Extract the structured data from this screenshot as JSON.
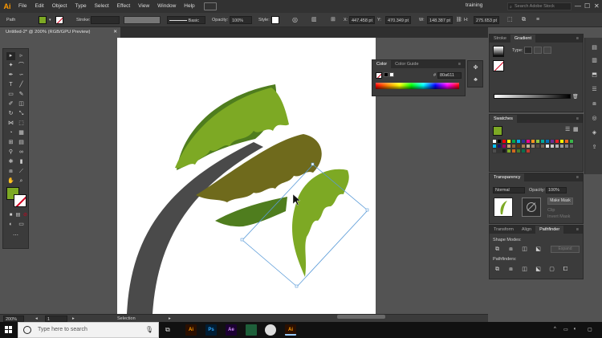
{
  "app": {
    "logo": "Ai",
    "menu": [
      "File",
      "Edit",
      "Object",
      "Type",
      "Select",
      "Effect",
      "View",
      "Window",
      "Help"
    ],
    "workspace": "training",
    "stock_search_placeholder": "Search Adobe Stock",
    "window_buttons": [
      "—",
      "☐",
      "✕"
    ]
  },
  "control_bar": {
    "selection_type": "Path",
    "stroke_label": "Stroke:",
    "brush_label": "Basic",
    "opacity_label": "Opacity:",
    "opacity_value": "100%",
    "style_label": "Style:",
    "x_label": "X:",
    "x_value": "447.458 pt",
    "y_label": "Y:",
    "y_value": "470.349 pt",
    "w_label": "W:",
    "w_value": "148.387 pt",
    "h_label": "H:",
    "h_value": "275.653 pt",
    "fill_color": "#7da924"
  },
  "document": {
    "tab_title": "Untitled-2* @ 200% (RGB/GPU Preview)",
    "close_glyph": "✕"
  },
  "status_bar": {
    "zoom": "200%",
    "artboard_number": "1",
    "tool_name": "Selection"
  },
  "color_panel": {
    "tabs": [
      "Color",
      "Color Guide"
    ],
    "hex_prefix": "#",
    "hex_value": "80a611"
  },
  "stroke_gradient_panel": {
    "tabs": [
      "Stroke",
      "Gradient"
    ],
    "type_label": "Type:"
  },
  "swatches_panel": {
    "title": "Swatches",
    "colors": [
      "#ffffff",
      "#000000",
      "#ff0000",
      "#ffff00",
      "#00a651",
      "#00aeef",
      "#2e3192",
      "#ec008c",
      "#f7941d",
      "#8dc63f",
      "#00a99d",
      "#0072bc",
      "#662d91",
      "#ed1c24",
      "#fff200",
      "#f26522",
      "#39b54a",
      "#00bff3",
      "#1b1464",
      "#9e005d",
      "#c69c6d",
      "#8c6239",
      "#603913",
      "#a67c52",
      "#c2b59b",
      "#998675",
      "#534741",
      "#736357",
      "#e6e6e6",
      "#cccccc",
      "#b3b3b3",
      "#999999",
      "#808080",
      "#666666",
      "#4d4d4d",
      "#333333",
      "#1a1a1a",
      "#7da924",
      "#d2691e",
      "#4a7c2a",
      "#0b6e4f",
      "#c0392b"
    ]
  },
  "transparency_panel": {
    "title": "Transparency",
    "blend_mode": "Normal",
    "opacity_label": "Opacity:",
    "opacity_value": "100%",
    "make_mask_label": "Make Mask",
    "clip_label": "Clip",
    "invert_mask_label": "Invert Mask"
  },
  "pathfinder_panel": {
    "tabs": [
      "Transform",
      "Align",
      "Pathfinder"
    ],
    "shape_modes_label": "Shape Modes:",
    "pathfinders_label": "Pathfinders:",
    "expand_label": "Expand"
  },
  "taskbar": {
    "search_placeholder": "Type here to search",
    "apps": [
      {
        "label": "Ai",
        "bg": "#2b0f00",
        "fg": "#ff9a00"
      },
      {
        "label": "Ps",
        "bg": "#001d34",
        "fg": "#31a8ff"
      },
      {
        "label": "Ae",
        "bg": "#1c0033",
        "fg": "#d291ff"
      },
      {
        "label": "",
        "bg": "#1e5f3a",
        "fg": "#ffffff"
      },
      {
        "label": "",
        "bg": "#dddddd",
        "fg": "#333333"
      },
      {
        "label": "Ai",
        "bg": "#2b0f00",
        "fg": "#ff9a00"
      }
    ]
  },
  "colors": {
    "leaf_light": "#7da924",
    "leaf_dark": "#4f7d1e",
    "leaf_olive": "#6f6a1c",
    "trunk": "#4a4a4a",
    "selection_blue": "#5a9bd8"
  }
}
